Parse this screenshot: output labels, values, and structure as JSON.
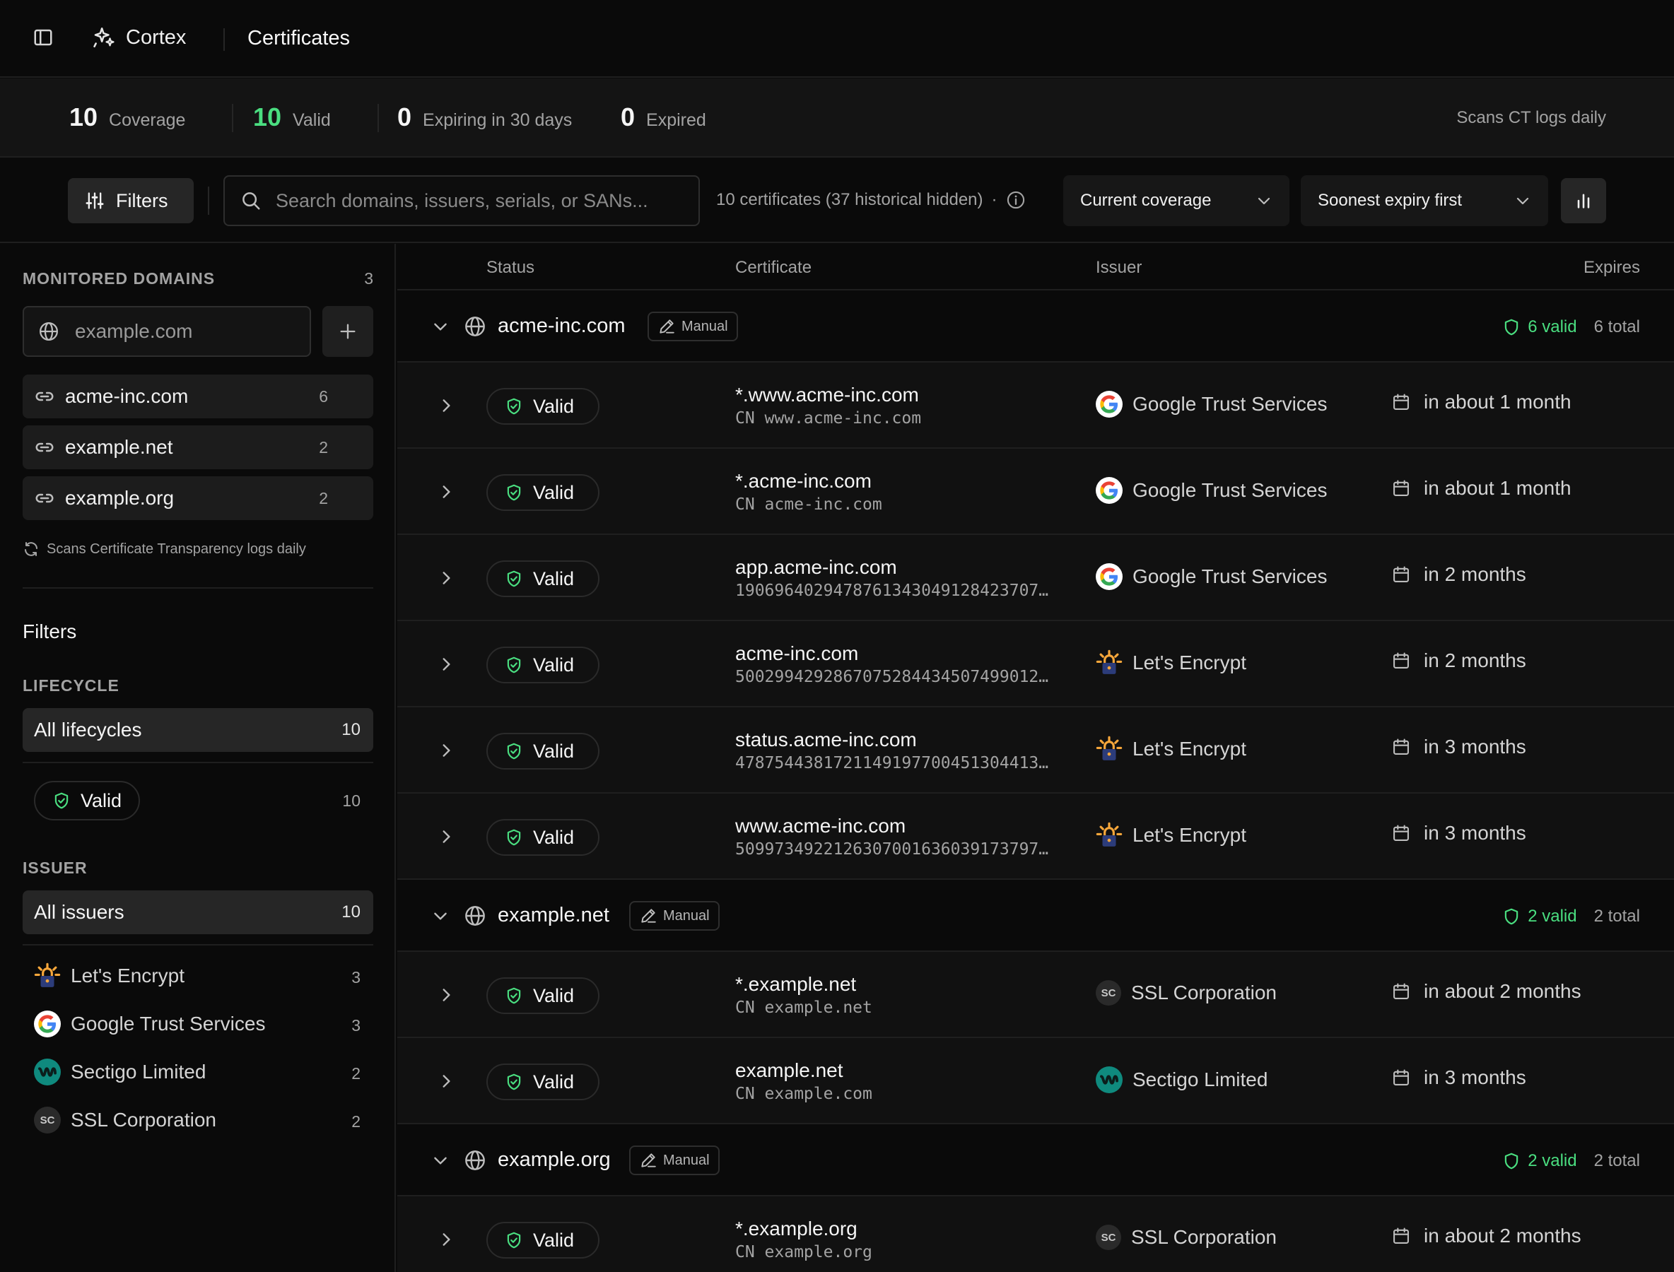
{
  "header": {
    "brand": "Cortex",
    "page_title": "Certificates"
  },
  "stats": {
    "coverage": {
      "value": "10",
      "label": "Coverage"
    },
    "valid": {
      "value": "10",
      "label": "Valid"
    },
    "expiring": {
      "value": "0",
      "label": "Expiring in 30 days"
    },
    "expired": {
      "value": "0",
      "label": "Expired"
    },
    "scan_note": "Scans CT logs daily"
  },
  "toolbar": {
    "filters_label": "Filters",
    "search_placeholder": "Search domains, issuers, serials, or SANs...",
    "count_text": "10 certificates (37 historical hidden)",
    "dot": "·",
    "coverage_select": "Current coverage",
    "sort_select": "Soonest expiry first"
  },
  "sidebar": {
    "monitored_title": "MONITORED DOMAINS",
    "monitored_count": "3",
    "domain_placeholder": "example.com",
    "domains": [
      {
        "name": "acme-inc.com",
        "count": "6"
      },
      {
        "name": "example.net",
        "count": "2"
      },
      {
        "name": "example.org",
        "count": "2"
      }
    ],
    "scan_note": "Scans Certificate Transparency logs daily",
    "filters_title": "Filters",
    "lifecycle_title": "LIFECYCLE",
    "all_lifecycles": {
      "label": "All lifecycles",
      "count": "10"
    },
    "valid_filter": {
      "label": "Valid",
      "count": "10"
    },
    "issuer_title": "ISSUER",
    "all_issuers": {
      "label": "All issuers",
      "count": "10"
    },
    "issuers": [
      {
        "name": "Let's Encrypt",
        "count": "3",
        "icon": "lets-encrypt-icon"
      },
      {
        "name": "Google Trust Services",
        "count": "3",
        "icon": "google-icon"
      },
      {
        "name": "Sectigo Limited",
        "count": "2",
        "icon": "sectigo-icon"
      },
      {
        "name": "SSL Corporation",
        "count": "2",
        "icon": "ssl-corp-icon",
        "abbr": "SC"
      }
    ]
  },
  "table": {
    "columns": {
      "status": "Status",
      "certificate": "Certificate",
      "issuer": "Issuer",
      "expires": "Expires"
    },
    "groups": [
      {
        "domain": "acme-inc.com",
        "badge": "Manual",
        "valid": "6 valid",
        "total": "6 total",
        "rows": [
          {
            "status": "Valid",
            "name": "*.www.acme-inc.com",
            "sub": "CN www.acme-inc.com",
            "issuer": "Google Trust Services",
            "issuer_icon": "google",
            "expires": "in about 1 month"
          },
          {
            "status": "Valid",
            "name": "*.acme-inc.com",
            "sub": "CN acme-inc.com",
            "issuer": "Google Trust Services",
            "issuer_icon": "google",
            "expires": "in about 1 month"
          },
          {
            "status": "Valid",
            "name": "app.acme-inc.com",
            "sub": "1906964029478761343049128423707…",
            "issuer": "Google Trust Services",
            "issuer_icon": "google",
            "expires": "in 2 months"
          },
          {
            "status": "Valid",
            "name": "acme-inc.com",
            "sub": "5002994292867075284434507499012…",
            "issuer": "Let's Encrypt",
            "issuer_icon": "le",
            "expires": "in 2 months"
          },
          {
            "status": "Valid",
            "name": "status.acme-inc.com",
            "sub": "4787544381721149197700451304413…",
            "issuer": "Let's Encrypt",
            "issuer_icon": "le",
            "expires": "in 3 months"
          },
          {
            "status": "Valid",
            "name": "www.acme-inc.com",
            "sub": "5099734922126307001636039173797…",
            "issuer": "Let's Encrypt",
            "issuer_icon": "le",
            "expires": "in 3 months"
          }
        ]
      },
      {
        "domain": "example.net",
        "badge": "Manual",
        "valid": "2 valid",
        "total": "2 total",
        "rows": [
          {
            "status": "Valid",
            "name": "*.example.net",
            "sub": "CN example.net",
            "issuer": "SSL Corporation",
            "issuer_icon": "sc",
            "expires": "in about 2 months"
          },
          {
            "status": "Valid",
            "name": "example.net",
            "sub": "CN example.com",
            "issuer": "Sectigo Limited",
            "issuer_icon": "sectigo",
            "expires": "in 3 months"
          }
        ]
      },
      {
        "domain": "example.org",
        "badge": "Manual",
        "valid": "2 valid",
        "total": "2 total",
        "rows": [
          {
            "status": "Valid",
            "name": "*.example.org",
            "sub": "CN example.org",
            "issuer": "SSL Corporation",
            "issuer_icon": "sc",
            "expires": "in about 2 months"
          }
        ]
      }
    ]
  }
}
